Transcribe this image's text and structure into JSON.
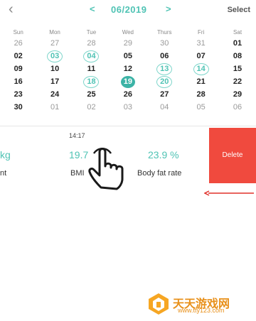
{
  "header": {
    "back_icon": "‹",
    "prev_icon": "<",
    "next_icon": ">",
    "month": "06/2019",
    "select_label": "Select"
  },
  "calendar": {
    "weekdays": [
      "Sun",
      "Mon",
      "Tue",
      "Wed",
      "Thurs",
      "Fri",
      "Sat"
    ],
    "weeks": [
      [
        {
          "d": "26",
          "s": "muted"
        },
        {
          "d": "27",
          "s": "muted"
        },
        {
          "d": "28",
          "s": "muted"
        },
        {
          "d": "29",
          "s": "muted"
        },
        {
          "d": "30",
          "s": "muted"
        },
        {
          "d": "31",
          "s": "muted"
        },
        {
          "d": "01",
          "s": ""
        }
      ],
      [
        {
          "d": "02",
          "s": ""
        },
        {
          "d": "03",
          "s": "ring"
        },
        {
          "d": "04",
          "s": "ring"
        },
        {
          "d": "05",
          "s": ""
        },
        {
          "d": "06",
          "s": ""
        },
        {
          "d": "07",
          "s": ""
        },
        {
          "d": "08",
          "s": ""
        }
      ],
      [
        {
          "d": "09",
          "s": ""
        },
        {
          "d": "10",
          "s": ""
        },
        {
          "d": "11",
          "s": ""
        },
        {
          "d": "12",
          "s": ""
        },
        {
          "d": "13",
          "s": "ring"
        },
        {
          "d": "14",
          "s": "ring"
        },
        {
          "d": "15",
          "s": ""
        }
      ],
      [
        {
          "d": "16",
          "s": ""
        },
        {
          "d": "17",
          "s": ""
        },
        {
          "d": "18",
          "s": "ring"
        },
        {
          "d": "19",
          "s": "sel"
        },
        {
          "d": "20",
          "s": "ring"
        },
        {
          "d": "21",
          "s": ""
        },
        {
          "d": "22",
          "s": ""
        }
      ],
      [
        {
          "d": "23",
          "s": ""
        },
        {
          "d": "24",
          "s": ""
        },
        {
          "d": "25",
          "s": ""
        },
        {
          "d": "26",
          "s": ""
        },
        {
          "d": "27",
          "s": ""
        },
        {
          "d": "28",
          "s": ""
        },
        {
          "d": "29",
          "s": ""
        }
      ],
      [
        {
          "d": "30",
          "s": ""
        },
        {
          "d": "01",
          "s": "muted"
        },
        {
          "d": "02",
          "s": "muted"
        },
        {
          "d": "03",
          "s": "muted"
        },
        {
          "d": "04",
          "s": "muted"
        },
        {
          "d": "05",
          "s": "muted"
        },
        {
          "d": "06",
          "s": "muted"
        }
      ]
    ]
  },
  "record": {
    "time": "14:17",
    "weight_value": "kg",
    "weight_label": "nt",
    "bmi_value": "19.7",
    "bmi_label": "BMI",
    "fat_value": "23.9 %",
    "fat_label": "Body fat rate",
    "delete_label": "Delete"
  },
  "watermark": {
    "title": "天天游戏网",
    "url": "www.tty123.com"
  },
  "colors": {
    "accent": "#4fc3b4",
    "selected": "#3cb3a6",
    "delete": "#f04a3e",
    "arrow": "#e0302a",
    "watermark": "#e8901a"
  },
  "icons": [
    "back-chevron-icon",
    "prev-month-icon",
    "next-month-icon",
    "hand-pointer-icon",
    "swipe-arrow-icon",
    "site-logo-icon"
  ]
}
